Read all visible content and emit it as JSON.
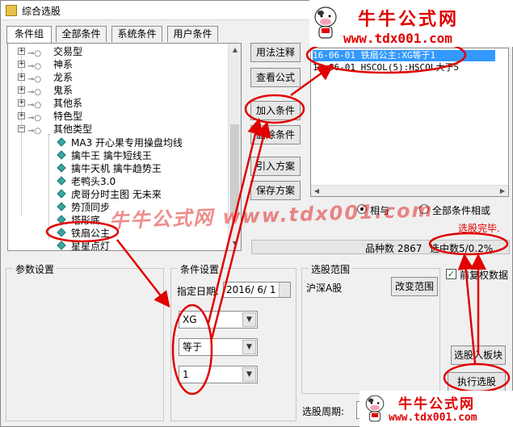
{
  "window": {
    "title": "综合选股"
  },
  "tabs": [
    {
      "label": "条件组",
      "active": true
    },
    {
      "label": "全部条件",
      "active": false
    },
    {
      "label": "系统条件",
      "active": false
    },
    {
      "label": "用户条件",
      "active": false
    }
  ],
  "tree": {
    "groups": [
      "交易型",
      "神系",
      "龙系",
      "鬼系",
      "其他系",
      "特色型",
      "其他类型"
    ],
    "items": [
      "MA3 开心果专用操盘均线",
      "擒牛王 擒牛短线王",
      "擒牛天机 擒牛趋势王",
      "老鸭头3.0",
      "虎哥分时主图 无未来",
      "势顶同步",
      "塔形底",
      "铁扇公主",
      "星星点灯"
    ]
  },
  "buttons": {
    "usage": "用法注释",
    "view_formula": "查看公式",
    "add_condition": "加入条件",
    "delete_condition": "删除条件",
    "import_plan": "引入方案",
    "save_plan": "保存方案",
    "change_range": "改变范围",
    "to_block": "选股入板块",
    "execute": "执行选股"
  },
  "condition_list": [
    {
      "text": "16-06-01 铁扇公主:XG等于1",
      "selected": true
    },
    {
      "text": "16-06-01 HSCOL(5):HSCOL大于5",
      "selected": false
    }
  ],
  "radios": {
    "and_label": "相与",
    "or_label": "全部条件相或"
  },
  "status": {
    "done": "选股完毕.",
    "variety_count_label": "品种数 2867",
    "selected_count": "选中数5/0.2%"
  },
  "params": {
    "title": "参数设置"
  },
  "cond_settings": {
    "title": "条件设置",
    "date_label": "指定日期:",
    "date_value": "2016/ 6/ 1",
    "combo1": "XG",
    "combo2": "等于",
    "combo3": "1"
  },
  "range": {
    "title": "选股范围",
    "value": "沪深A股",
    "restore_label": "前复权数据",
    "restore_checked": true
  },
  "period": {
    "label": "选股周期:"
  },
  "watermark": {
    "title": "牛牛公式网",
    "url": "www.tdx001.com",
    "diagonal": "牛牛公式网 www.tdx001.com"
  },
  "colors": {
    "annotation": "#e00000",
    "selection": "#3399ff"
  }
}
